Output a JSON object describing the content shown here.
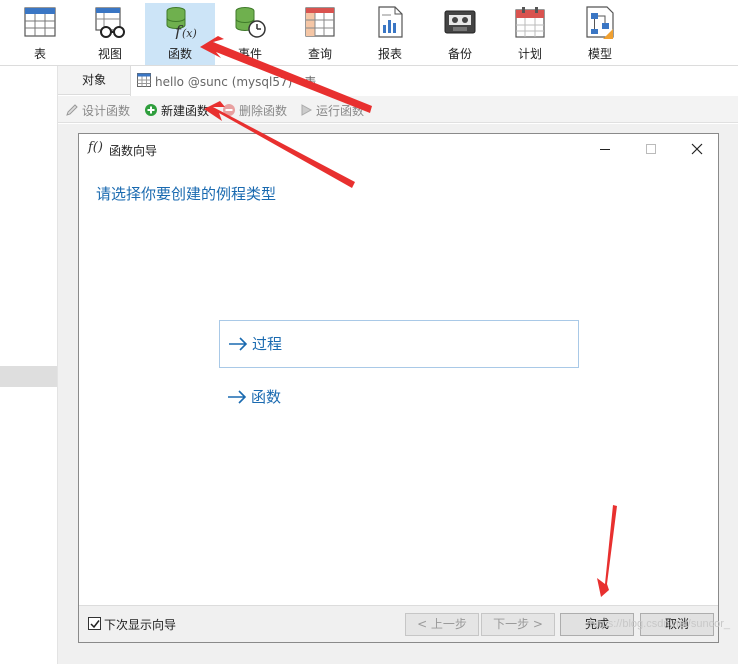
{
  "ribbon": {
    "items": [
      {
        "label": "表"
      },
      {
        "label": "视图"
      },
      {
        "label": "函数"
      },
      {
        "label": "事件"
      },
      {
        "label": "查询"
      },
      {
        "label": "报表"
      },
      {
        "label": "备份"
      },
      {
        "label": "计划"
      },
      {
        "label": "模型"
      }
    ],
    "active_index": 2
  },
  "tabs": {
    "objects_label": "对象",
    "query_tab_text": "hello @sunc (mysql57) - 表"
  },
  "object_toolbar": {
    "design": "设计函数",
    "new": "新建函数",
    "delete": "删除函数",
    "run": "运行函数"
  },
  "dialog": {
    "title": "函数向导",
    "heading": "请选择你要创建的例程类型",
    "choices": [
      "过程",
      "函数"
    ],
    "show_next_time": "下次显示向导",
    "show_next_time_checked": true,
    "buttons": {
      "prev": "< 上一步",
      "next": "下一步 >",
      "finish": "完成",
      "cancel": "取消"
    }
  },
  "watermark": "https://blog.csdn.net/suncor_",
  "colors": {
    "accent": "#1a6ab0",
    "active_tab_bg": "#cce4f7",
    "arrow_red": "#e8302f"
  }
}
